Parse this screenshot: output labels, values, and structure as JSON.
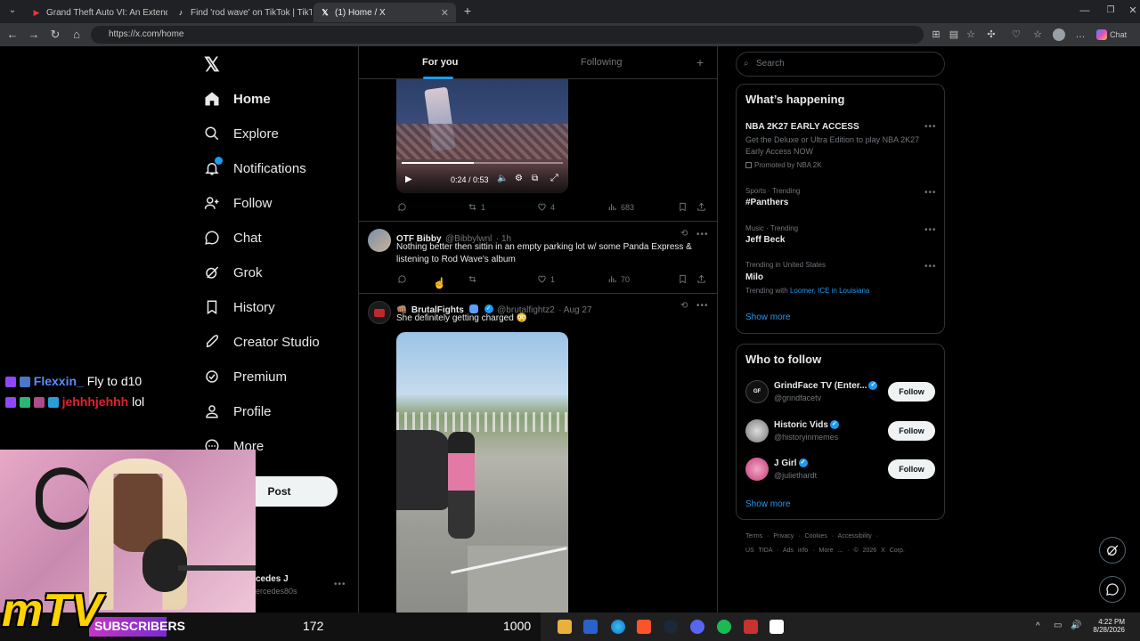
{
  "browser": {
    "tabs": [
      {
        "title": "Grand Theft Auto VI: An Extended",
        "active": false
      },
      {
        "title": "Find 'rod wave' on TikTok | TikTok",
        "active": false
      },
      {
        "title": "(1) Home / X",
        "active": true
      }
    ],
    "url": "https://x.com/home",
    "copilot_label": "Chat"
  },
  "sidebar": {
    "items": [
      {
        "label": "Home",
        "icon": "home-icon"
      },
      {
        "label": "Explore",
        "icon": "search-icon"
      },
      {
        "label": "Notifications",
        "icon": "bell-icon"
      },
      {
        "label": "Follow",
        "icon": "person-add-icon"
      },
      {
        "label": "Chat",
        "icon": "chat-icon"
      },
      {
        "label": "Grok",
        "icon": "grok-icon"
      },
      {
        "label": "History",
        "icon": "bookmark-icon"
      },
      {
        "label": "Creator Studio",
        "icon": "rocket-icon"
      },
      {
        "label": "Premium",
        "icon": "premium-icon"
      },
      {
        "label": "Profile",
        "icon": "person-icon"
      },
      {
        "label": "More",
        "icon": "more-icon"
      }
    ],
    "post_label": "Post",
    "account_name": "cedes J",
    "account_handle": "ercedes80s"
  },
  "feed": {
    "tabs": [
      "For you",
      "Following"
    ],
    "video1": {
      "time": "0:24 / 0:53",
      "progress": 0.45
    },
    "tweet0_stats": {
      "replies": "",
      "reposts": "1",
      "likes": "4",
      "views": "683"
    },
    "tweet1": {
      "name": "OTF Bibby",
      "handle": "@Bibbylwnl",
      "time": "· 1h",
      "text": "Nothing better then sittin in an empty parking lot w/ some Panda Express & listening to Rod Wave's album",
      "replies": "",
      "reposts": "",
      "likes": "1",
      "views": "70"
    },
    "tweet2": {
      "name": "BrutalFights",
      "handle": "@brutalfightz2",
      "time": "· Aug 27",
      "text": "She definitely getting charged 😳"
    }
  },
  "right": {
    "search_placeholder": "Search",
    "whats_happening": "What’s happening",
    "trends": [
      {
        "context": "",
        "title": "NBA 2K27 EARLY ACCESS",
        "sub": "Get the Deluxe or Ultra Edition to play NBA 2K27 Early Access NOW",
        "promo": "Promoted by NBA 2K"
      },
      {
        "context": "Sports · Trending",
        "title": "#Panthers",
        "sub": ""
      },
      {
        "context": "Music · Trending",
        "title": "Jeff Beck",
        "sub": ""
      },
      {
        "context": "Trending in United States",
        "title": "Milo",
        "sub_prefix": "Trending with",
        "sub_links": "Loomer, ICE in Louisiana"
      }
    ],
    "show_more": "Show more",
    "who_to_follow": "Who to follow",
    "follows": [
      {
        "name": "GrindFace TV (Enter...",
        "handle": "@grindfacetv",
        "button": "Follow"
      },
      {
        "name": "Historic Vids",
        "handle": "@historyinmemes",
        "button": "Follow"
      },
      {
        "name": "J Girl",
        "handle": "@juliethardt",
        "button": "Follow"
      }
    ],
    "footer": [
      "Terms",
      "·",
      "Privacy",
      "·",
      "Cookies",
      "·",
      "Accessibility",
      "·"
    ],
    "footer2": [
      "US TIDA",
      "·",
      "Ads info",
      "·",
      "More ...",
      "·",
      "© 2026 X Corp."
    ]
  },
  "stream": {
    "chat": [
      {
        "user": "Flexxin_",
        "message": "Fly to d10",
        "color": "#5b8cff"
      },
      {
        "user": "jehhhjehhh",
        "message": "lol",
        "color": "#e0212b"
      }
    ],
    "subscribers_label": "SUBSCRIBERS",
    "sub_count": "172",
    "sub_goal": "1000",
    "logo": "mTV"
  },
  "taskbar": {
    "time": "4:22 PM",
    "date": "8/28/2026"
  }
}
